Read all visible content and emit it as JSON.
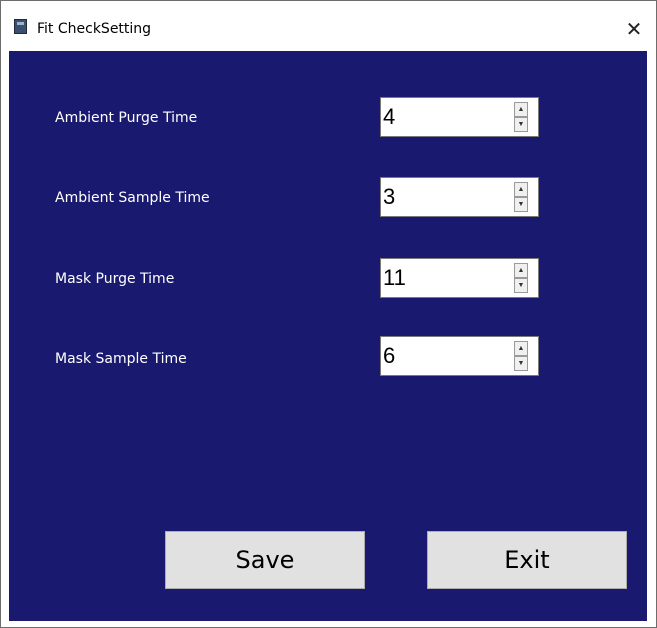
{
  "window": {
    "title": "Fit CheckSetting",
    "close_glyph": "✕",
    "background_color": "#191970"
  },
  "fields": [
    {
      "label": "Ambient Purge Time",
      "value": "4"
    },
    {
      "label": "Ambient Sample Time",
      "value": "3"
    },
    {
      "label": "Mask Purge Time",
      "value": "11"
    },
    {
      "label": "Mask Sample Time",
      "value": "6"
    }
  ],
  "icons": {
    "app": "app-icon",
    "close": "close-icon",
    "spin_up": "chevron-up-icon",
    "spin_down": "chevron-down-icon"
  },
  "spin": {
    "up": "▲",
    "down": "▼"
  },
  "buttons": {
    "save_label": "Save",
    "exit_label": "Exit"
  }
}
